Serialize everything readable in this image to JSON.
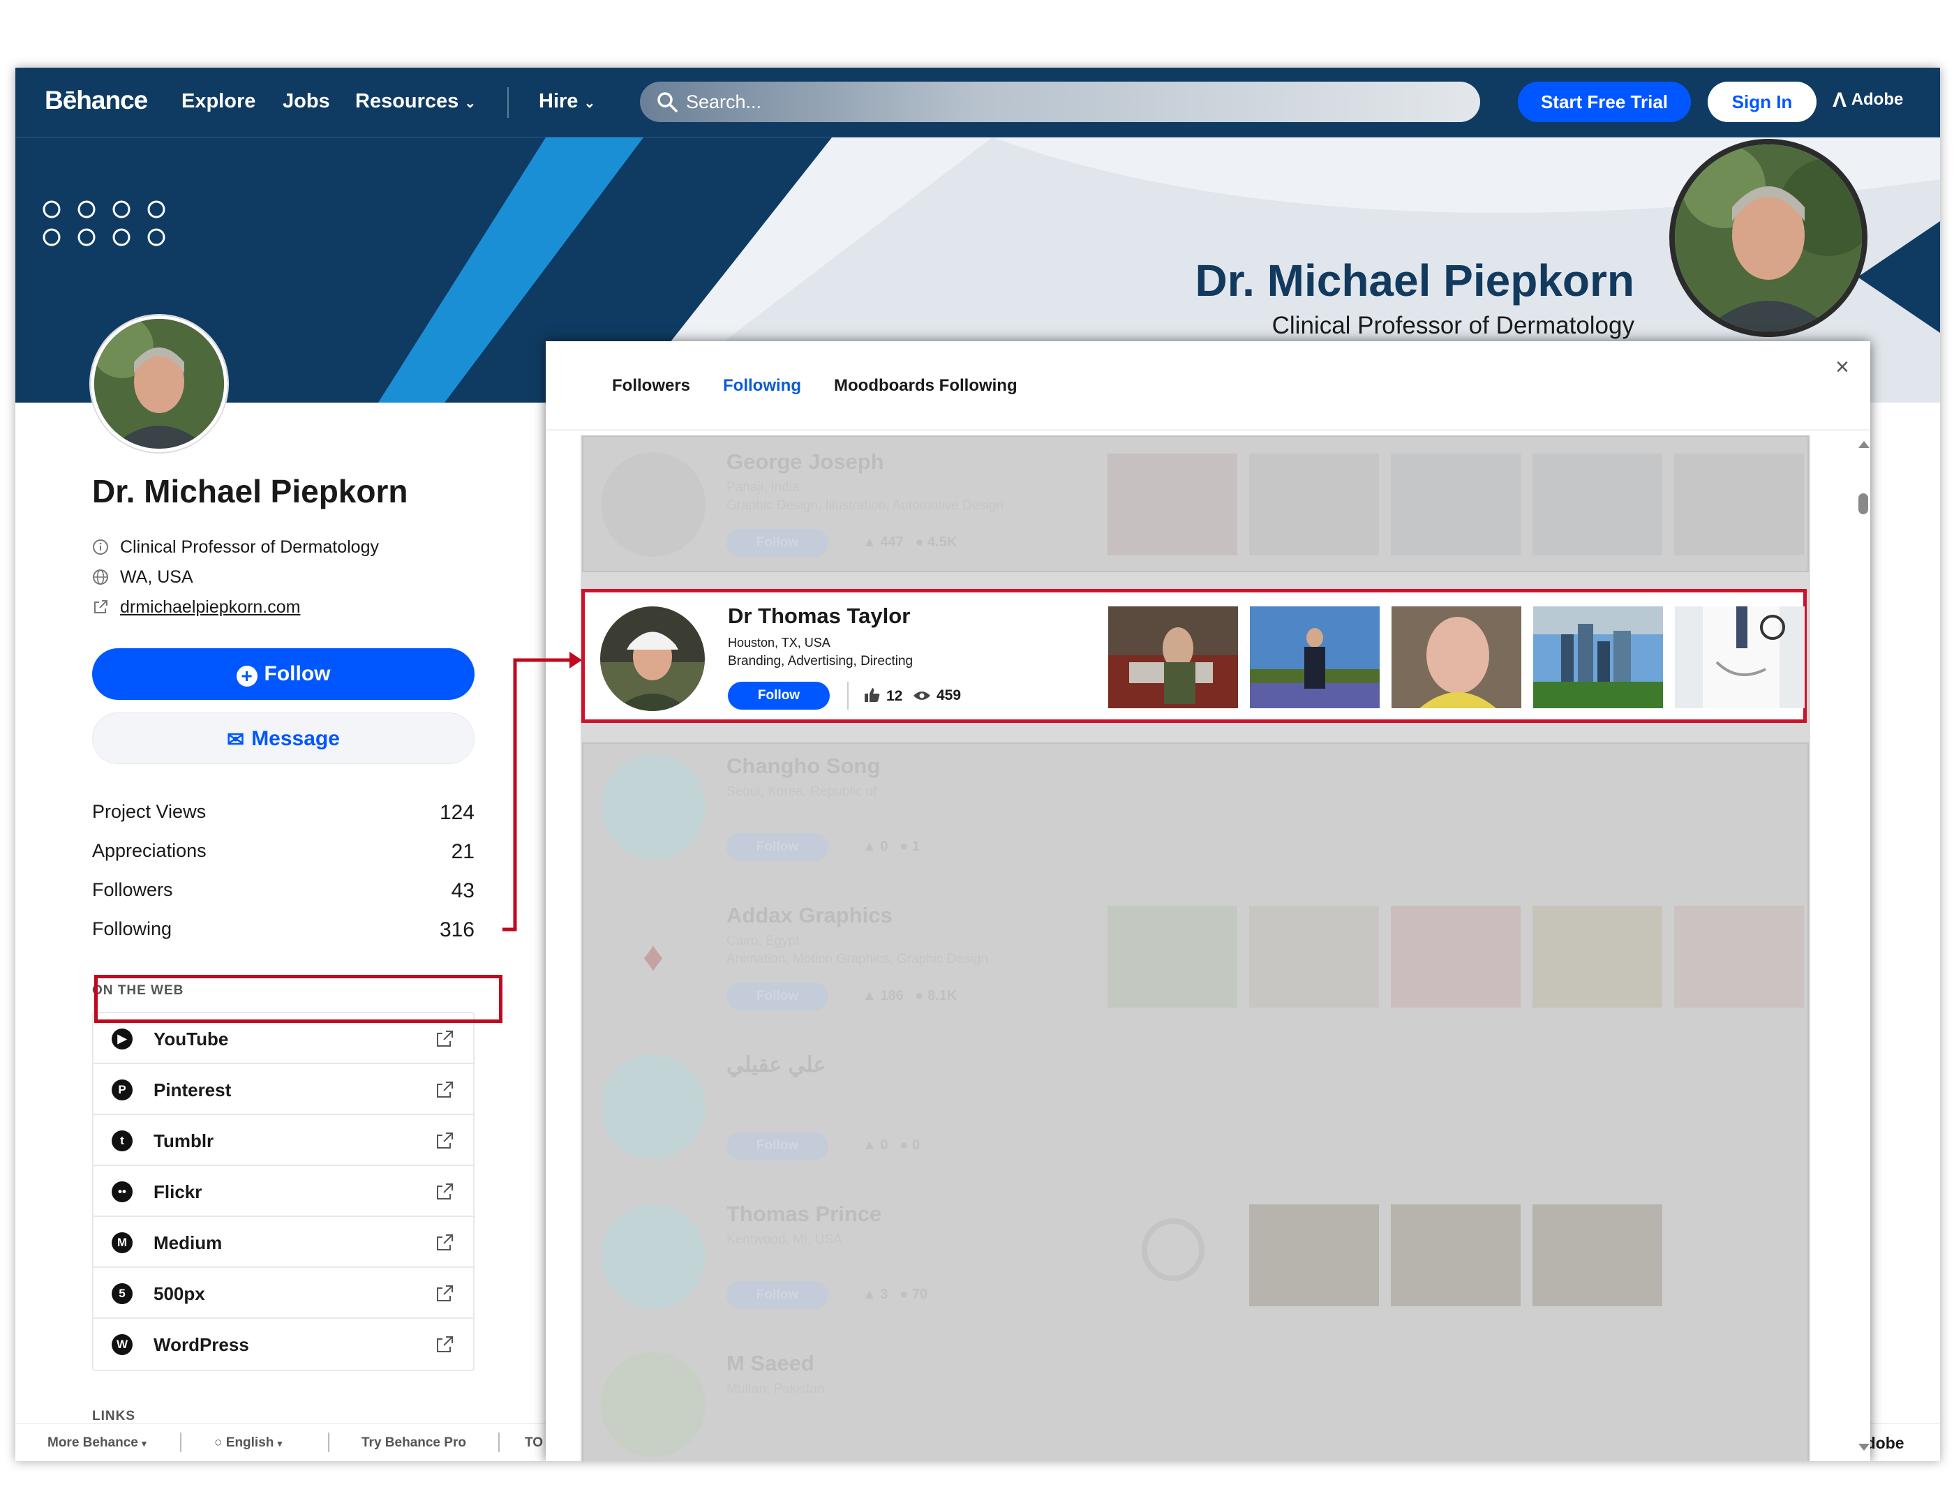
{
  "nav": {
    "logo": "Bēhance",
    "links": [
      "Explore",
      "Jobs",
      "Resources",
      "Hire"
    ],
    "search_placeholder": "Search...",
    "start_trial": "Start Free Trial",
    "sign_in": "Sign In",
    "adobe": "Adobe"
  },
  "banner": {
    "name": "Dr. Michael Piepkorn",
    "role": "Clinical Professor of Dermatology"
  },
  "profile": {
    "name": "Dr. Michael Piepkorn",
    "occupation": "Clinical Professor of Dermatology",
    "location": "WA, USA",
    "website": "drmichaelpiepkorn.com",
    "follow_label": "Follow",
    "message_label": "Message",
    "stats": [
      {
        "label": "Project Views",
        "value": "124"
      },
      {
        "label": "Appreciations",
        "value": "21"
      },
      {
        "label": "Followers",
        "value": "43"
      },
      {
        "label": "Following",
        "value": "316"
      }
    ],
    "on_the_web_label": "ON THE WEB",
    "web_links": [
      {
        "label": "YouTube",
        "icon": "youtube-icon"
      },
      {
        "label": "Pinterest",
        "icon": "pinterest-icon"
      },
      {
        "label": "Tumblr",
        "icon": "tumblr-icon"
      },
      {
        "label": "Flickr",
        "icon": "flickr-icon"
      },
      {
        "label": "Medium",
        "icon": "medium-icon"
      },
      {
        "label": "500px",
        "icon": "500px-icon"
      },
      {
        "label": "WordPress",
        "icon": "wordpress-icon"
      }
    ],
    "links_label": "LINKS"
  },
  "footer": {
    "more": "More Behance",
    "lang": "English",
    "pro": "Try Behance Pro",
    "tou": "TO",
    "adobe": "Adobe"
  },
  "modal": {
    "tabs": [
      "Followers",
      "Following",
      "Moodboards Following"
    ],
    "active_tab": "Following",
    "close": "×",
    "users": [
      {
        "name": "George Joseph",
        "location": "Panaji, India",
        "fields": "Graphic Design, Illustration, Automotive Design",
        "follow": "Follow",
        "likes": "447",
        "views": "4.5K"
      },
      {
        "name": "Dr Thomas Taylor",
        "location": "Houston, TX, USA",
        "fields": "Branding, Advertising, Directing",
        "follow": "Follow",
        "likes": "12",
        "views": "459"
      },
      {
        "name": "Changho Song",
        "location": "Seoul, Korea, Republic of",
        "follow": "Follow",
        "likes": "0",
        "views": "1"
      },
      {
        "name": "Addax Graphics",
        "location": "Cairo, Egypt",
        "fields": "Animation, Motion Graphics, Graphic Design",
        "follow": "Follow",
        "likes": "186",
        "views": "8.1K"
      },
      {
        "name": "علي عقيلي",
        "follow": "Follow",
        "likes": "0",
        "views": "0"
      },
      {
        "name": "Thomas Prince",
        "location": "Kentwood, MI, USA",
        "follow": "Follow",
        "likes": "3",
        "views": "70"
      },
      {
        "name": "M Saeed",
        "location": "Multan, Pakistan"
      }
    ]
  },
  "colors": {
    "navy": "#0f3b62",
    "accent_blue": "#0057ff",
    "highlight_red": "#c0091f"
  }
}
